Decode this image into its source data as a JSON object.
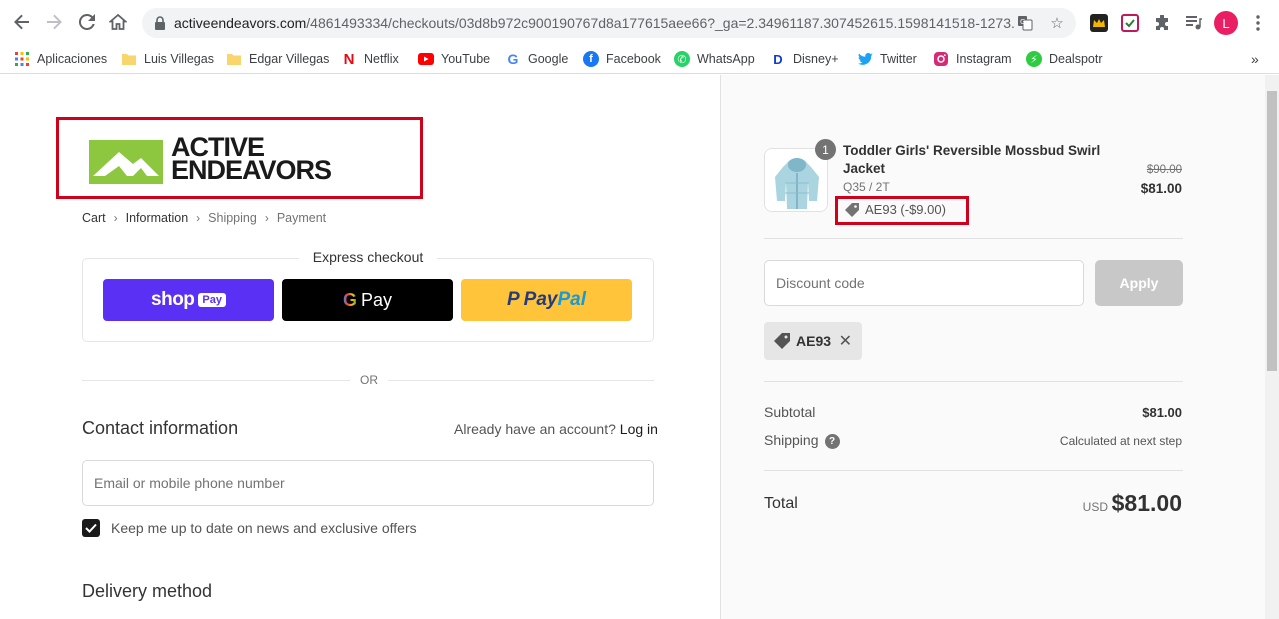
{
  "browser": {
    "url_host": "activeendeavors.com",
    "url_path": "/4861493334/checkouts/03d8b972c900190767d8a177615aee66?_ga=2.34961187.307452615.1598141518-1273...",
    "profile_initial": "L",
    "bookmarks": [
      {
        "label": "Aplicaciones",
        "icon": "apps-grid-icon"
      },
      {
        "label": "Luis Villegas",
        "icon": "folder-icon"
      },
      {
        "label": "Edgar Villegas",
        "icon": "folder-icon"
      },
      {
        "label": "Netflix",
        "icon": "netflix-icon"
      },
      {
        "label": "YouTube",
        "icon": "youtube-icon"
      },
      {
        "label": "Google",
        "icon": "google-icon"
      },
      {
        "label": "Facebook",
        "icon": "facebook-icon"
      },
      {
        "label": "WhatsApp",
        "icon": "whatsapp-icon"
      },
      {
        "label": "Disney+",
        "icon": "disney-icon"
      },
      {
        "label": "Twitter",
        "icon": "twitter-icon"
      },
      {
        "label": "Instagram",
        "icon": "instagram-icon"
      },
      {
        "label": "Dealspotr",
        "icon": "dealspotr-icon"
      }
    ],
    "more_bookmarks": "»"
  },
  "store": {
    "logo_line1": "ACTIVE",
    "logo_line2": "ENDEAVORS",
    "brand_green": "#8dc63f"
  },
  "breadcrumb": {
    "cart": "Cart",
    "information": "Information",
    "shipping": "Shipping",
    "payment": "Payment"
  },
  "express": {
    "title": "Express checkout",
    "shop_label": "shop",
    "shop_pay": "Pay",
    "gpay_label": "Pay",
    "paypal_pay": "Pay",
    "paypal_pal": "Pal"
  },
  "or_text": "OR",
  "contact": {
    "title": "Contact information",
    "account_prompt": "Already have an account?",
    "login": "Log in",
    "email_placeholder": "Email or mobile phone number",
    "newsletter_label": "Keep me up to date on news and exclusive offers",
    "newsletter_checked": true
  },
  "delivery": {
    "title": "Delivery method"
  },
  "order": {
    "quantity": "1",
    "product_name": "Toddler Girls' Reversible Mossbud Swirl Jacket",
    "variant": "Q35 / 2T",
    "original_price": "$90.00",
    "price": "$81.00",
    "discount_tag": "AE93 (-$9.00)",
    "discount_placeholder": "Discount code",
    "apply": "Apply",
    "applied_code": "AE93",
    "subtotal_label": "Subtotal",
    "subtotal_value": "$81.00",
    "shipping_label": "Shipping",
    "shipping_value": "Calculated at next step",
    "total_label": "Total",
    "currency": "USD",
    "total_value": "$81.00"
  },
  "colors": {
    "highlight": "#d0021b",
    "shop_pay": "#5a31f4",
    "paypal": "#ffc439"
  }
}
